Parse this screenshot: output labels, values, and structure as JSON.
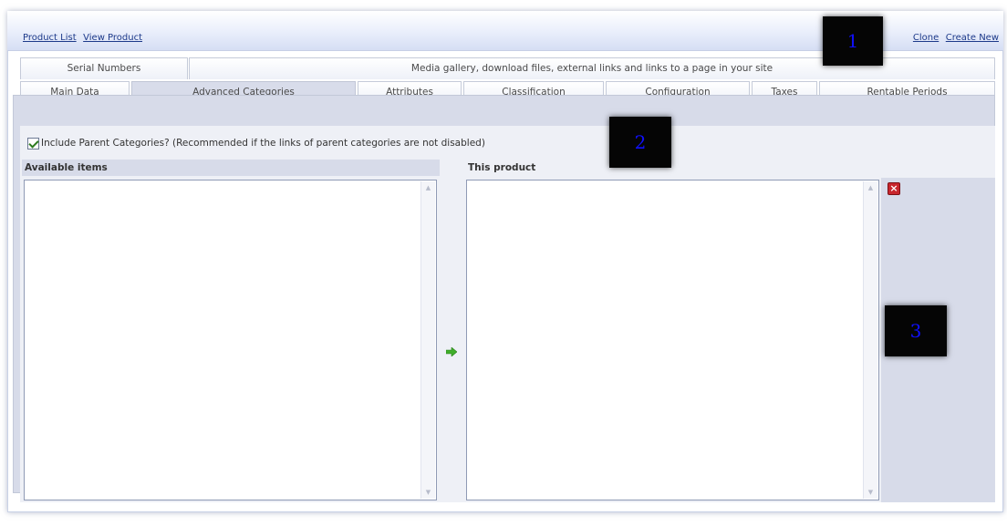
{
  "nav": {
    "product_list": "Product List",
    "view_product": "View Product",
    "clone": "Clone",
    "create_new": "Create New"
  },
  "tabs_row1": [
    {
      "label": "Serial Numbers"
    },
    {
      "label": "Media gallery, download files, external links and links to a page in your site"
    }
  ],
  "tabs_row2": [
    {
      "label": "Main Data"
    },
    {
      "label": "Advanced Categories",
      "active": true
    },
    {
      "label": "Attributes"
    },
    {
      "label": "Classification"
    },
    {
      "label": "Configuration"
    },
    {
      "label": "Taxes"
    },
    {
      "label": "Rentable Periods"
    }
  ],
  "include_parent": {
    "checked": true,
    "label": "Include Parent Categories? (Recommended if the links of parent categories are not disabled)"
  },
  "lists": {
    "available_label": "Available items",
    "selected_label": "This product"
  },
  "markers": [
    "1",
    "2",
    "3"
  ],
  "icons": {
    "move_arrow": "arrow-right-icon",
    "remove": "delete-icon"
  },
  "colors": {
    "link": "#1d3a8a",
    "panel_bg": "#d7dbe9",
    "arrow": "#3fae2a",
    "delete": "#c8262d",
    "marker_text": "#1010ff"
  }
}
